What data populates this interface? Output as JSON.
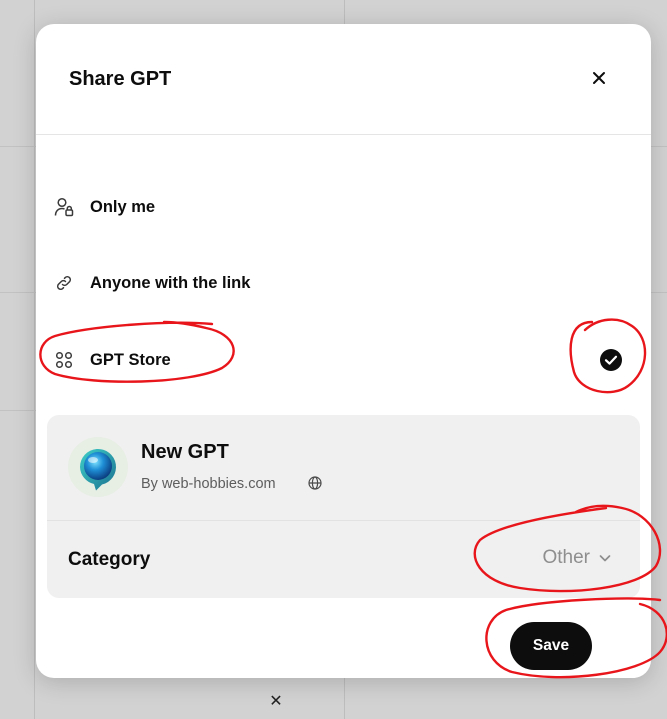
{
  "dialog": {
    "title": "Share GPT"
  },
  "options": [
    {
      "label": "Only me",
      "icon": "user-lock-icon",
      "selected": false
    },
    {
      "label": "Anyone with the link",
      "icon": "link-icon",
      "selected": false
    },
    {
      "label": "GPT Store",
      "icon": "grid-icon",
      "selected": true
    }
  ],
  "gpt": {
    "name": "New GPT",
    "author": "By web-hobbies.com"
  },
  "category": {
    "label": "Category",
    "value": "Other"
  },
  "actions": {
    "save_label": "Save"
  },
  "background": {
    "close_glyph": "✕"
  },
  "colors": {
    "primary_button": "#0d0d0d",
    "card_bg": "#f0f0f0",
    "annotation": "#e8161b"
  }
}
